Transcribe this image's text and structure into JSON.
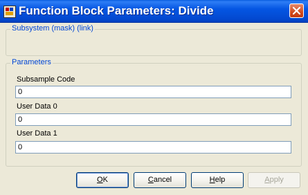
{
  "window": {
    "title": "Function Block Parameters: Divide",
    "close_icon": "close-icon",
    "app_icon": "simulink-block-icon"
  },
  "subsystem_group": {
    "label": "Subsystem (mask) (link)"
  },
  "parameters_group": {
    "label": "Parameters",
    "fields": [
      {
        "label": "Subsample Code",
        "value": "0"
      },
      {
        "label": "User Data 0",
        "value": "0"
      },
      {
        "label": "User Data 1",
        "value": "0"
      }
    ]
  },
  "buttons": {
    "ok": {
      "mnemonic": "O",
      "rest": "K"
    },
    "cancel": {
      "mnemonic": "C",
      "rest": "ancel"
    },
    "help": {
      "mnemonic": "H",
      "rest": "elp"
    },
    "apply": {
      "mnemonic": "A",
      "rest": "pply",
      "enabled": false
    }
  },
  "colors": {
    "title_bar": "#0556E3",
    "group_label": "#0046D5",
    "dialog_bg": "#ECE9D8",
    "close_button": "#D24B1E"
  }
}
